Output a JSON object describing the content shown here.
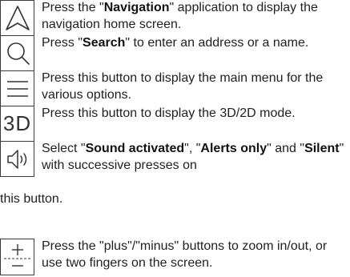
{
  "entries": [
    {
      "icon": "navigation-arrow-icon",
      "parts": [
        {
          "text": "Press the \"",
          "bold": false
        },
        {
          "text": "Navigation",
          "bold": true
        },
        {
          "text": "\" application to display the navigation home screen.",
          "bold": false
        }
      ]
    },
    {
      "icon": "search-icon",
      "parts": [
        {
          "text": "Press \"",
          "bold": false
        },
        {
          "text": "Search",
          "bold": true
        },
        {
          "text": "\" to enter an address or a name.",
          "bold": false
        }
      ]
    },
    {
      "icon": "menu-icon",
      "parts": [
        {
          "text": "Press this button to display the main menu for the various options.",
          "bold": false
        }
      ]
    },
    {
      "icon": "3d-icon",
      "icon_text": "3D",
      "parts": [
        {
          "text": "Press this button to display the 3D/2D mode.",
          "bold": false
        }
      ]
    },
    {
      "icon": "speaker-icon",
      "parts": [
        {
          "text": "Select \"",
          "bold": false
        },
        {
          "text": "Sound activated",
          "bold": true
        },
        {
          "text": "\", \"",
          "bold": false
        },
        {
          "text": "Alerts only",
          "bold": true
        },
        {
          "text": "\" and \"",
          "bold": false
        },
        {
          "text": "Silent",
          "bold": true
        },
        {
          "text": "\" with successive presses on",
          "bold": false
        }
      ],
      "continuation": "this button."
    },
    {
      "icon": "zoom-plus-minus-icon",
      "parts": [
        {
          "text": "Press the \"plus\"/\"minus\" buttons to zoom in/out, or use two fingers on the screen.",
          "bold": false
        }
      ]
    }
  ]
}
